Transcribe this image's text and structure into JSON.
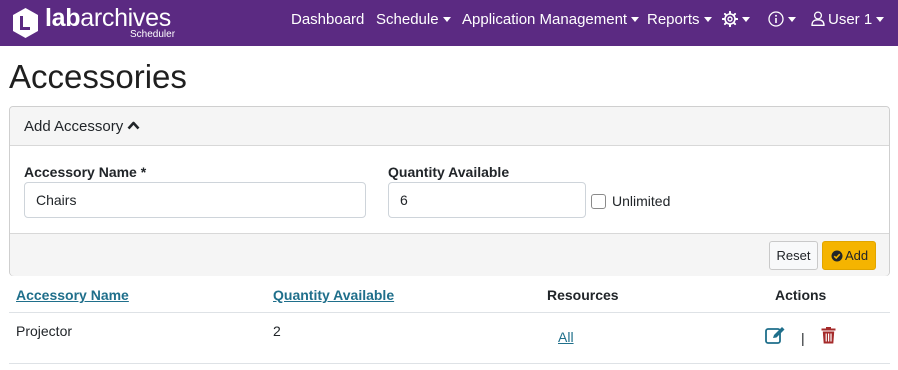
{
  "brand": {
    "name_bold": "lab",
    "name_light": "archives",
    "subtitle": "Scheduler"
  },
  "nav": {
    "dashboard": "Dashboard",
    "schedule": "Schedule",
    "application_management": "Application Management",
    "reports": "Reports",
    "user": "User 1"
  },
  "page": {
    "title": "Accessories"
  },
  "form": {
    "header_label": "Add Accessory",
    "accessory_name_label": "Accessory Name *",
    "accessory_name_value": "Chairs",
    "quantity_label": "Quantity Available",
    "quantity_value": "6",
    "unlimited_label": "Unlimited",
    "unlimited_checked": false,
    "reset_label": "Reset",
    "add_label": "Add"
  },
  "table": {
    "headers": [
      "Accessory Name",
      "Quantity Available",
      "Resources",
      "Actions"
    ],
    "rows": [
      {
        "name": "Projector",
        "quantity": "2",
        "resources": "All",
        "separator": "|"
      }
    ]
  },
  "colors": {
    "navbar": "#5b2a82",
    "link": "#1f6f8b",
    "add_button": "#f5b400",
    "edit_icon": "#1f6f8b",
    "delete_icon": "#a52a2a"
  }
}
